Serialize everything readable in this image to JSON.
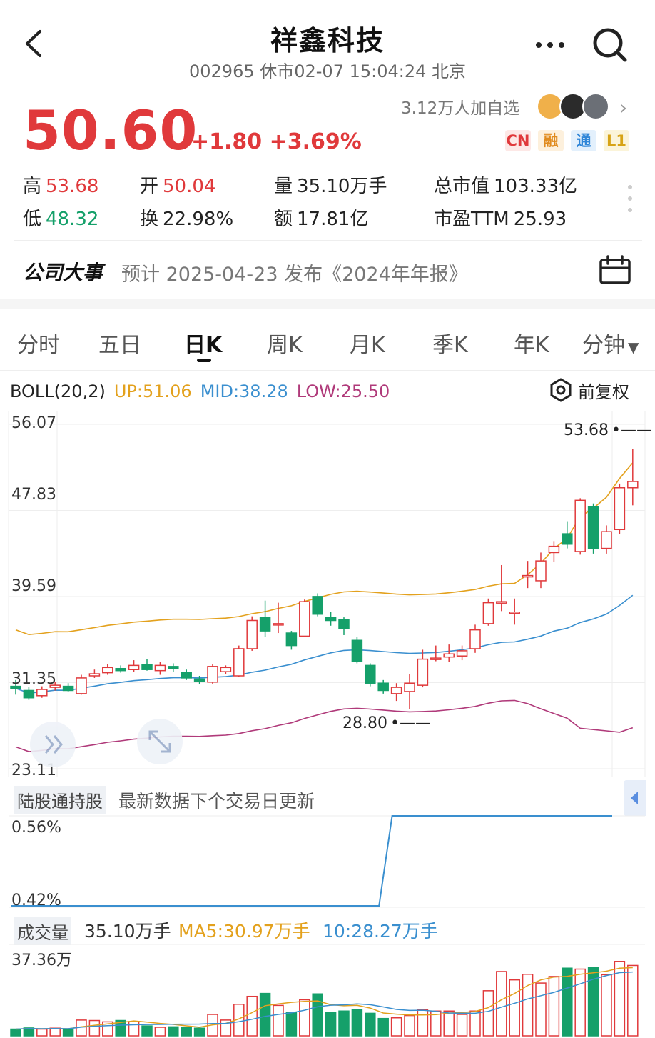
{
  "header": {
    "title": "祥鑫科技",
    "subtitle": "002965 休市02-07 15:04:24 北京"
  },
  "quote": {
    "price": "50.60",
    "change": "+1.80 +3.69%",
    "watchers": "3.12万人加自选",
    "tags": [
      "CN",
      "融",
      "通",
      "L1"
    ],
    "stats": [
      {
        "label": "高",
        "value": "53.68",
        "color": "#e0393b"
      },
      {
        "label": "开",
        "value": "50.04",
        "color": "#e0393b"
      },
      {
        "label": "量",
        "value": "35.10万手",
        "color": "#222222"
      },
      {
        "label": "总市值",
        "value": "103.33亿",
        "color": "#222222"
      },
      {
        "label": "低",
        "value": "48.32",
        "color": "#15a06a"
      },
      {
        "label": "换",
        "value": "22.98%",
        "color": "#222222"
      },
      {
        "label": "额",
        "value": "17.81亿",
        "color": "#222222"
      },
      {
        "label": "市盈TTM",
        "value": "25.93",
        "color": "#222222"
      }
    ]
  },
  "event": {
    "title": "公司大事",
    "text": "预计 2025-04-23 发布《2024年年报》"
  },
  "tabs": [
    {
      "label": "分时",
      "active": false
    },
    {
      "label": "五日",
      "active": false
    },
    {
      "label": "日K",
      "active": true
    },
    {
      "label": "周K",
      "active": false
    },
    {
      "label": "月K",
      "active": false
    },
    {
      "label": "季K",
      "active": false
    },
    {
      "label": "年K",
      "active": false
    },
    {
      "label": "分钟",
      "active": false
    }
  ],
  "boll": {
    "name": "BOLL(20,2)",
    "up": "UP:51.06",
    "mid": "MID:38.28",
    "low": "LOW:25.50",
    "adjust": "前复权"
  },
  "price_axis": [
    "56.07",
    "47.83",
    "39.59",
    "31.35",
    "23.11"
  ],
  "annotations": {
    "high": "53.68",
    "low": "28.80"
  },
  "holdings": {
    "label": "陆股通持股",
    "text": "最新数据下个交易日更新",
    "axis": [
      "0.56%",
      "0.42%"
    ]
  },
  "volume": {
    "label": "成交量",
    "value": "35.10万手",
    "ma5": "MA5:30.97万手",
    "ma10": "10:28.27万手",
    "axis_top": "37.36万"
  },
  "colors": {
    "up": "#e0393b",
    "down": "#15a06a",
    "boll_up": "#e3a11d",
    "boll_mid": "#3a8fcf",
    "boll_low": "#b03a7a"
  },
  "chart_data": {
    "type": "candlestick",
    "ylim": [
      23.11,
      56.07
    ],
    "candles": [
      {
        "o": 31.0,
        "c": 30.8,
        "h": 31.6,
        "l": 30.2
      },
      {
        "o": 30.6,
        "c": 29.9,
        "h": 30.9,
        "l": 29.7
      },
      {
        "o": 30.1,
        "c": 30.7,
        "h": 31.0,
        "l": 29.9
      },
      {
        "o": 30.9,
        "c": 31.1,
        "h": 31.4,
        "l": 30.6
      },
      {
        "o": 31.0,
        "c": 30.6,
        "h": 31.3,
        "l": 30.5
      },
      {
        "o": 30.3,
        "c": 31.8,
        "h": 32.1,
        "l": 30.2
      },
      {
        "o": 32.0,
        "c": 32.2,
        "h": 32.6,
        "l": 31.8
      },
      {
        "o": 32.3,
        "c": 32.8,
        "h": 33.1,
        "l": 32.1
      },
      {
        "o": 32.7,
        "c": 32.5,
        "h": 33.0,
        "l": 32.3
      },
      {
        "o": 32.6,
        "c": 33.0,
        "h": 33.5,
        "l": 32.4
      },
      {
        "o": 33.1,
        "c": 32.6,
        "h": 33.6,
        "l": 32.5
      },
      {
        "o": 32.5,
        "c": 33.0,
        "h": 33.3,
        "l": 32.1
      },
      {
        "o": 32.9,
        "c": 32.7,
        "h": 33.2,
        "l": 32.4
      },
      {
        "o": 32.3,
        "c": 31.8,
        "h": 32.6,
        "l": 31.6
      },
      {
        "o": 31.7,
        "c": 31.5,
        "h": 32.0,
        "l": 31.2
      },
      {
        "o": 31.4,
        "c": 32.9,
        "h": 33.1,
        "l": 31.2
      },
      {
        "o": 32.4,
        "c": 32.8,
        "h": 33.0,
        "l": 32.2
      },
      {
        "o": 32.0,
        "c": 34.6,
        "h": 34.9,
        "l": 31.9
      },
      {
        "o": 34.6,
        "c": 37.3,
        "h": 37.7,
        "l": 34.4
      },
      {
        "o": 37.6,
        "c": 36.3,
        "h": 39.2,
        "l": 35.7
      },
      {
        "o": 37.0,
        "c": 37.0,
        "h": 39.0,
        "l": 36.1
      },
      {
        "o": 36.1,
        "c": 34.9,
        "h": 36.3,
        "l": 34.5
      },
      {
        "o": 35.8,
        "c": 39.1,
        "h": 39.3,
        "l": 35.7
      },
      {
        "o": 39.6,
        "c": 37.9,
        "h": 39.9,
        "l": 37.7
      },
      {
        "o": 37.6,
        "c": 37.3,
        "h": 38.1,
        "l": 36.8
      },
      {
        "o": 37.4,
        "c": 36.5,
        "h": 37.6,
        "l": 35.9
      },
      {
        "o": 35.4,
        "c": 33.4,
        "h": 35.7,
        "l": 33.2
      },
      {
        "o": 33.0,
        "c": 31.3,
        "h": 33.2,
        "l": 31.0
      },
      {
        "o": 31.3,
        "c": 30.6,
        "h": 31.6,
        "l": 30.3
      },
      {
        "o": 30.3,
        "c": 30.9,
        "h": 31.3,
        "l": 29.6
      },
      {
        "o": 30.5,
        "c": 31.3,
        "h": 32.2,
        "l": 28.8
      },
      {
        "o": 31.1,
        "c": 33.6,
        "h": 34.5,
        "l": 30.9
      },
      {
        "o": 33.7,
        "c": 33.7,
        "h": 34.9,
        "l": 33.4
      },
      {
        "o": 33.8,
        "c": 34.1,
        "h": 35.0,
        "l": 33.3
      },
      {
        "o": 33.9,
        "c": 34.4,
        "h": 34.9,
        "l": 33.5
      },
      {
        "o": 34.6,
        "c": 36.4,
        "h": 36.9,
        "l": 34.2
      },
      {
        "o": 37.0,
        "c": 39.0,
        "h": 39.4,
        "l": 36.8
      },
      {
        "o": 39.1,
        "c": 39.1,
        "h": 42.6,
        "l": 38.2
      },
      {
        "o": 38.1,
        "c": 38.1,
        "h": 39.4,
        "l": 36.9
      },
      {
        "o": 41.6,
        "c": 41.6,
        "h": 43.0,
        "l": 40.4
      },
      {
        "o": 41.1,
        "c": 43.0,
        "h": 43.8,
        "l": 40.4
      },
      {
        "o": 43.8,
        "c": 44.4,
        "h": 44.9,
        "l": 42.9
      },
      {
        "o": 45.6,
        "c": 44.6,
        "h": 46.8,
        "l": 44.2
      },
      {
        "o": 43.9,
        "c": 48.8,
        "h": 49.0,
        "l": 43.6
      },
      {
        "o": 48.2,
        "c": 44.2,
        "h": 48.5,
        "l": 43.7
      },
      {
        "o": 44.2,
        "c": 45.8,
        "h": 46.4,
        "l": 43.7
      },
      {
        "o": 46.0,
        "c": 50.0,
        "h": 50.4,
        "l": 45.6
      },
      {
        "o": 50.0,
        "c": 50.6,
        "h": 53.68,
        "l": 48.32
      }
    ],
    "holdings_ylim": [
      0.42,
      0.56
    ],
    "holdings_series": [
      0.42,
      0.42,
      0.42,
      0.42,
      0.42,
      0.42,
      0.42,
      0.42,
      0.42,
      0.42,
      0.42,
      0.42,
      0.42,
      0.42,
      0.42,
      0.42,
      0.42,
      0.42,
      0.42,
      0.42,
      0.42,
      0.42,
      0.42,
      0.42,
      0.42,
      0.42,
      0.42,
      0.42,
      0.42,
      0.56,
      0.56,
      0.56,
      0.56,
      0.56,
      0.56,
      0.56,
      0.56,
      0.56,
      0.56,
      0.56,
      0.56,
      0.56,
      0.56,
      0.56,
      0.56,
      0.56
    ],
    "volume_ylim": [
      0,
      37.36
    ],
    "volumes": [
      3,
      3.5,
      3,
      3.4,
      3,
      7,
      6.8,
      6.2,
      6.8,
      6.3,
      4.4,
      3.8,
      4,
      3.6,
      3.4,
      9.5,
      7,
      14,
      17.5,
      18.8,
      13.5,
      10.5,
      16,
      18.6,
      10.5,
      11,
      11.5,
      10,
      7.7,
      8,
      9,
      11.5,
      11,
      11,
      9.5,
      11,
      20,
      28.5,
      24.8,
      27.3,
      23.4,
      26.3,
      30,
      29.6,
      30.3,
      27.1,
      33,
      31.2
    ]
  }
}
